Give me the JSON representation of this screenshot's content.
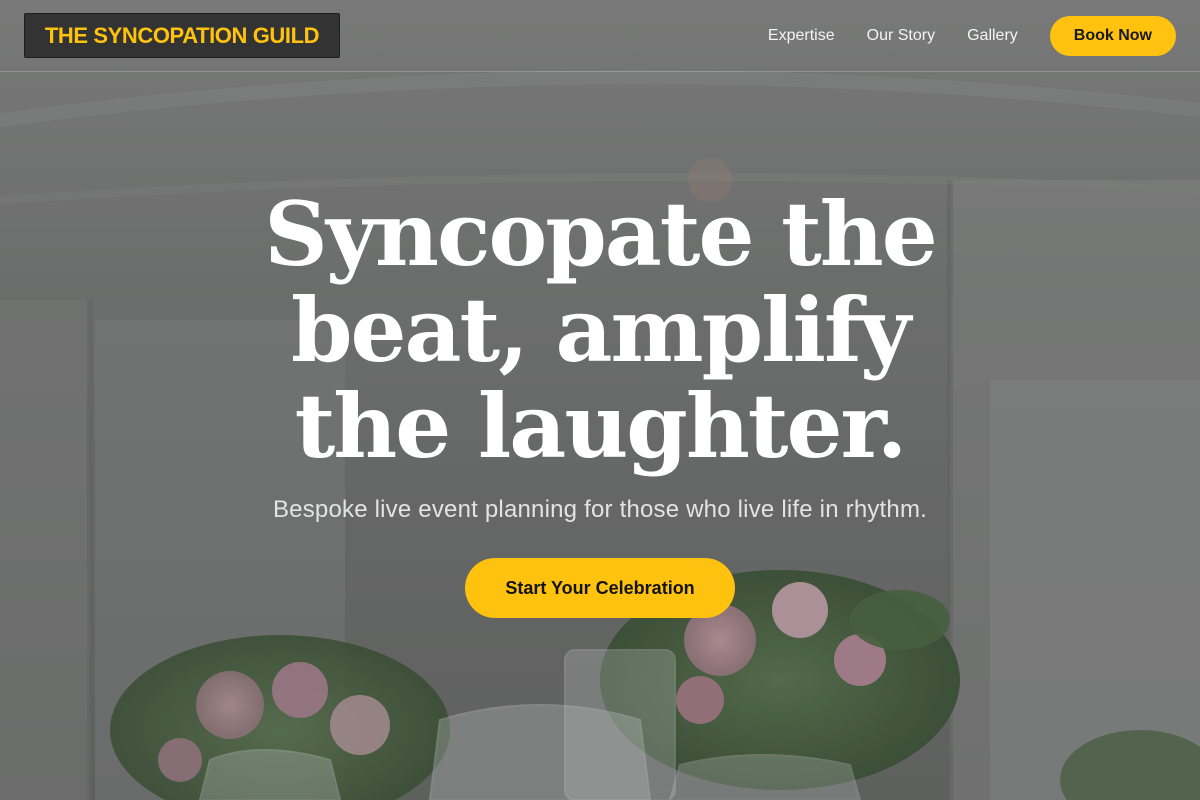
{
  "brand": {
    "name": "THE SYNCOPATION GUILD"
  },
  "nav": {
    "links": [
      "Expertise",
      "Our Story",
      "Gallery"
    ],
    "book_label": "Book Now"
  },
  "hero": {
    "title": "Syncopate the beat, amplify the laughter.",
    "subtitle": "Bespoke live event planning for those who live life in rhythm.",
    "cta_label": "Start Your Celebration"
  },
  "colors": {
    "accent": "#ffc20e",
    "brand_bg": "#333333"
  }
}
